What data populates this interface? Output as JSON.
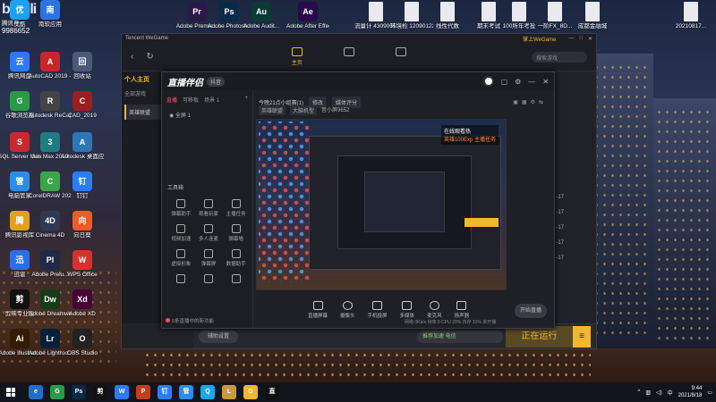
{
  "watermark": {
    "logo": "bilibili",
    "sub": "腾讯号",
    "id": "9986652"
  },
  "desktop": {
    "icons": [
      {
        "label": "腾讯网盘",
        "abbr": "云",
        "color": "#2a7bff"
      },
      {
        "label": "AutoCAD 2019 - 简...",
        "abbr": "A",
        "color": "#c8262b"
      },
      {
        "label": "回收站",
        "abbr": "回",
        "color": "#4b5a78"
      },
      {
        "label": "谷歌浏览器",
        "abbr": "G",
        "color": "#2b9a48"
      },
      {
        "label": "Autodesk ReCap",
        "abbr": "R",
        "color": "#444"
      },
      {
        "label": "CAD_2019",
        "abbr": "C",
        "color": "#9a1e22"
      },
      {
        "label": "SQL Server Managem...",
        "abbr": "S",
        "color": "#c8282e"
      },
      {
        "label": "3ds Max 2019",
        "abbr": "3",
        "color": "#1d7d80"
      },
      {
        "label": "Autodesk 桌面应用程序",
        "abbr": "A",
        "color": "#2e77b7"
      },
      {
        "label": "电脑管家",
        "abbr": "管",
        "color": "#2b8de6"
      },
      {
        "label": "CorelDRAW 2020 (64...",
        "abbr": "C",
        "color": "#3ba54a"
      },
      {
        "label": "钉钉",
        "abbr": "钉",
        "color": "#2a7dfa"
      },
      {
        "label": "腾讯影视库",
        "abbr": "腾",
        "color": "#e2a11d"
      },
      {
        "label": "Cinema 4D",
        "abbr": "4D",
        "color": "#2e3a52"
      },
      {
        "label": "向日葵",
        "abbr": "向",
        "color": "#f05a28"
      },
      {
        "label": "迅雷",
        "abbr": "迅",
        "color": "#2a6fe8"
      },
      {
        "label": "Adobe Prelu...",
        "abbr": "Pl",
        "color": "#1f2a4a"
      },
      {
        "label": "WPS Office",
        "abbr": "W",
        "color": "#d9302b"
      },
      {
        "label": "剪映专业版",
        "abbr": "剪",
        "color": "#111"
      },
      {
        "label": "Adobe Dreamwe...",
        "abbr": "Dw",
        "color": "#153d18"
      },
      {
        "label": "Adobe XD",
        "abbr": "Xd",
        "color": "#470137"
      },
      {
        "label": "Adobe Illustrat...",
        "abbr": "Ai",
        "color": "#331c00"
      },
      {
        "label": "Adobe Lightroo...",
        "abbr": "Lr",
        "color": "#06203a"
      },
      {
        "label": "OBS Studio",
        "abbr": "O",
        "color": "#222"
      },
      {
        "label": "优酷",
        "abbr": "优",
        "color": "#1da1f2"
      },
      {
        "label": "南软应用",
        "abbr": "南",
        "color": "#2b72e6"
      }
    ],
    "top_icons": [
      {
        "label": "Adobe Premie...",
        "abbr": "Pr",
        "color": "#2a1a4a"
      },
      {
        "label": "Adobe Photosh...",
        "abbr": "Ps",
        "color": "#0a2a4a"
      },
      {
        "label": "Adobe Audit...",
        "abbr": "Au",
        "color": "#0a3a38"
      },
      {
        "label": "Adobe After Effects CC",
        "abbr": "Ae",
        "color": "#2a0a4a"
      },
      {
        "label": "流量计 43090017",
        "abbr": "",
        "color": "#e8eaf0"
      },
      {
        "label": "环境检 12090122",
        "abbr": "",
        "color": "#e8eaf0"
      },
      {
        "label": "线性代数",
        "abbr": "",
        "color": "#e8eaf0"
      },
      {
        "label": "期末考试",
        "abbr": "",
        "color": "#e8eaf0"
      },
      {
        "label": "100所年考投",
        "abbr": "",
        "color": "#e8eaf0"
      },
      {
        "label": "一阶FX_8D...",
        "abbr": "",
        "color": "#e8eaf0"
      },
      {
        "label": "成都金融城",
        "abbr": "",
        "color": "#e8eaf0"
      },
      {
        "label": "20210817...",
        "abbr": "",
        "color": "#e8eaf0"
      }
    ]
  },
  "wegame": {
    "title": "Tencent WeGame",
    "brand": "掌上WeGame",
    "tabs": [
      {
        "label": "主页",
        "active": true
      },
      {
        "label": "",
        "active": false
      },
      {
        "label": "",
        "active": false
      }
    ],
    "nav_items": [
      "",
      "",
      "",
      "",
      ""
    ],
    "search_placeholder": "搜索游戏",
    "sidebar_header": "全部游戏",
    "sidebar_brand": "个人主页",
    "sidebar_item": "英雄联盟",
    "times": [
      "-17",
      "-17",
      "-17",
      "-17",
      "-17"
    ],
    "assist_label": "辅助设置",
    "accel_label": "推荐加速 电信",
    "running_label": "正在运行",
    "menu_icon": "≡"
  },
  "zhibo": {
    "app_name": "直播伴侣",
    "version": "抖音",
    "tabs": [
      "直播",
      "可移板",
      "场景 1"
    ],
    "scene_label": "全屏 1",
    "info_title": "今晚21点小组赛(1)",
    "info_chip1": "修改",
    "info_chip2": "媒体评分",
    "info_chip3": "英雄联盟",
    "info_chip4": "大脑机型",
    "info_chip5": "音小屏9652",
    "tools_title": "工具箱",
    "tools": [
      {
        "label": "弹幕助手"
      },
      {
        "label": "观看玩家"
      },
      {
        "label": "主播任务"
      },
      {
        "label": "视频加速"
      },
      {
        "label": "多人连麦"
      },
      {
        "label": "弹幕墙"
      },
      {
        "label": "虚拟形象"
      },
      {
        "label": "弹幕屏"
      },
      {
        "label": "数据助手"
      },
      {
        "label": ""
      },
      {
        "label": ""
      },
      {
        "label": ""
      }
    ],
    "notice": "5条直播中的新功能",
    "preview_badge_1": "在线观看热",
    "preview_badge_2": "英雄100Exp 主播任务",
    "bottom_buttons": [
      "直播屏幕",
      "摄像头",
      "手机投屏",
      "多媒体",
      "麦克风",
      "扬声器"
    ],
    "live_button": "开始直播",
    "status_text": "网络 0Kb/s   帧率 0   CPU 20%   内存 31%   未开播"
  },
  "taskbar": {
    "apps": [
      {
        "abbr": "e",
        "color": "#1e6fc8"
      },
      {
        "abbr": "G",
        "color": "#2b9a48"
      },
      {
        "abbr": "Ps",
        "color": "#0a2a4a"
      },
      {
        "abbr": "剪",
        "color": "#111"
      },
      {
        "abbr": "W",
        "color": "#2a7bff"
      },
      {
        "abbr": "P",
        "color": "#c43e1c"
      },
      {
        "abbr": "钉",
        "color": "#2a7dfa"
      },
      {
        "abbr": "管",
        "color": "#2b8de6"
      },
      {
        "abbr": "Q",
        "color": "#1ca6f0"
      },
      {
        "abbr": "L",
        "color": "#c89b3c"
      },
      {
        "abbr": "G",
        "color": "#f2b731"
      },
      {
        "abbr": "直",
        "color": "#111"
      }
    ],
    "time": "9:44",
    "date": "2021/8/18",
    "lang": "中"
  }
}
